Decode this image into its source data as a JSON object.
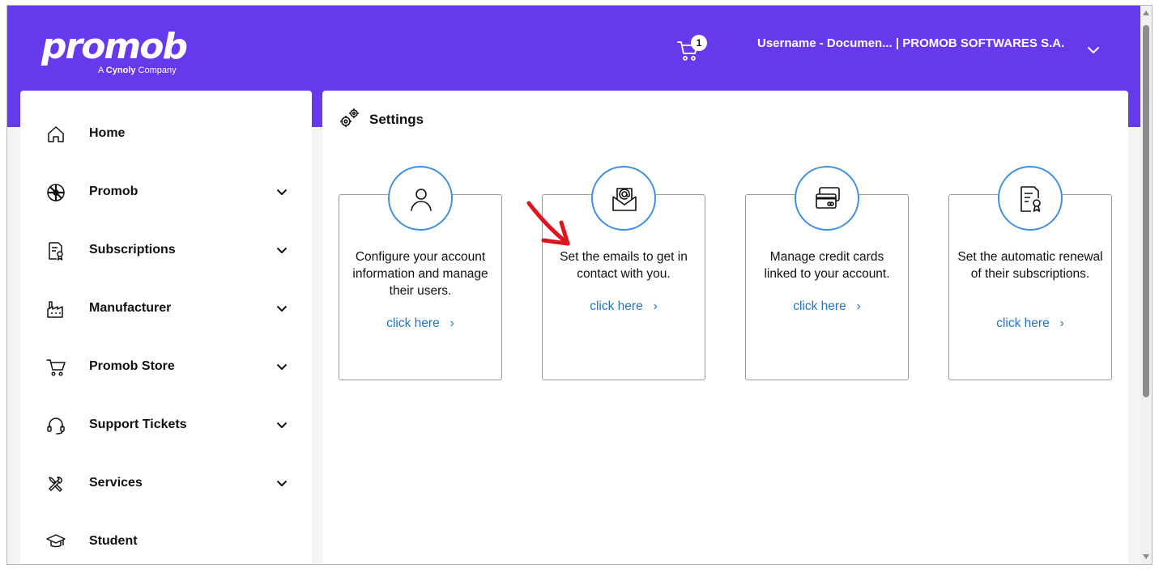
{
  "header": {
    "logo_text": "promob",
    "logo_sub_prefix": "A",
    "logo_sub_brand": "Cynoly",
    "logo_sub_suffix": "Company",
    "cart_count": "1",
    "user_text": "Username - Documen... | PROMOB SOFTWARES S.A."
  },
  "sidebar": {
    "items": [
      {
        "label": "Home",
        "icon": "home-icon",
        "has_chevron": false
      },
      {
        "label": "Promob",
        "icon": "promob-icon",
        "has_chevron": true
      },
      {
        "label": "Subscriptions",
        "icon": "subscriptions-icon",
        "has_chevron": true
      },
      {
        "label": "Manufacturer",
        "icon": "factory-icon",
        "has_chevron": true
      },
      {
        "label": "Promob Store",
        "icon": "cart-icon",
        "has_chevron": true
      },
      {
        "label": "Support Tickets",
        "icon": "headset-icon",
        "has_chevron": true
      },
      {
        "label": "Services",
        "icon": "tools-icon",
        "has_chevron": true
      },
      {
        "label": "Student",
        "icon": "graduation-cap-icon",
        "has_chevron": false
      }
    ]
  },
  "main": {
    "title": "Settings",
    "cards": [
      {
        "text": "Configure your account information and manage their users.",
        "link": "click here",
        "icon": "user-icon"
      },
      {
        "text": "Set the emails to get in contact with you.",
        "link": "click here",
        "icon": "email-icon"
      },
      {
        "text": "Manage credit cards linked to your account.",
        "link": "click here",
        "icon": "credit-card-icon"
      },
      {
        "text": "Set the automatic renewal of their subscriptions.",
        "link": "click here",
        "icon": "certificate-icon"
      }
    ]
  },
  "colors": {
    "header_bg": "#6639ea",
    "accent_blue": "#3e8fe3",
    "link_blue": "#1f73c9",
    "annotation_red": "#e0141e"
  }
}
